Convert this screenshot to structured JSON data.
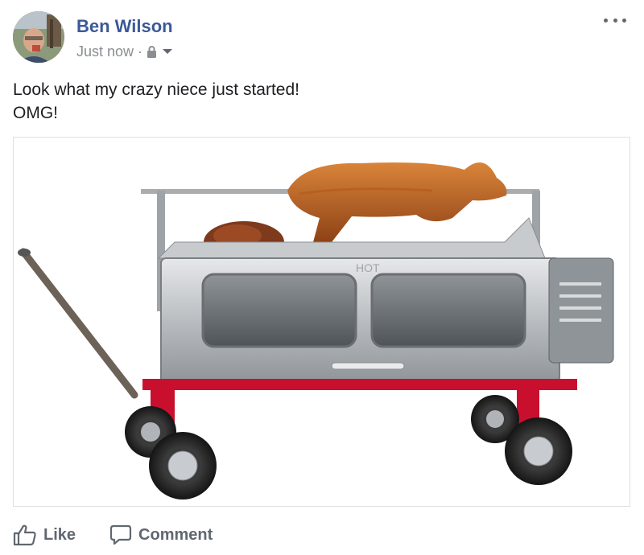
{
  "post": {
    "author": "Ben Wilson",
    "timestamp": "Just now",
    "separator": "·",
    "privacy_icon": "lock-icon",
    "audience_dropdown_icon": "caret-down-icon",
    "more_icon": "ellipsis-icon",
    "text_lines": [
      "Look what my crazy niece just started!",
      "OMG!"
    ],
    "image_alt": "Stainless steel rotisserie roaster cart with a pig on a spit"
  },
  "actions": {
    "like_label": "Like",
    "like_icon": "thumbs-up-icon",
    "comment_label": "Comment",
    "comment_icon": "speech-bubble-icon"
  },
  "colors": {
    "author": "#3b5998",
    "meta": "#8a8d91",
    "text": "#1c1e21",
    "action": "#606770",
    "border": "#dddfe2"
  }
}
